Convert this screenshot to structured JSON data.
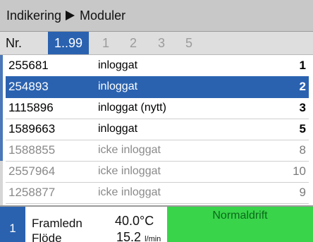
{
  "header": {
    "crumbs": [
      "Indikering",
      "Moduler"
    ]
  },
  "filters": {
    "label": "Nr.",
    "active": "1..99",
    "options": [
      "1",
      "2",
      "3",
      "5"
    ]
  },
  "rows": [
    {
      "nr": "255681",
      "status": "inloggat",
      "count": "1",
      "state": "normal"
    },
    {
      "nr": "254893",
      "status": "inloggat",
      "count": "2",
      "state": "selected"
    },
    {
      "nr": "1115896",
      "status": "inloggat (nytt)",
      "count": "3",
      "state": "normal"
    },
    {
      "nr": "1589663",
      "status": "inloggat",
      "count": "5",
      "state": "normal"
    },
    {
      "nr": "1588855",
      "status": "icke inloggat",
      "count": "8",
      "state": "dim"
    },
    {
      "nr": "2557964",
      "status": "icke inloggat",
      "count": "10",
      "state": "dim"
    },
    {
      "nr": "1258877",
      "status": "icke inloggat",
      "count": "9",
      "state": "dim"
    }
  ],
  "status_bar": {
    "index": "1",
    "items": [
      {
        "label": "Framledn",
        "value": "40.0°C"
      },
      {
        "label": "Flöde",
        "value": "15.2",
        "unit": "l/min"
      }
    ],
    "mode": "Normaldrift"
  },
  "colors": {
    "accent": "#2a62b0",
    "mode_green": "#39d44a",
    "header_grey": "#c8c8c8"
  }
}
